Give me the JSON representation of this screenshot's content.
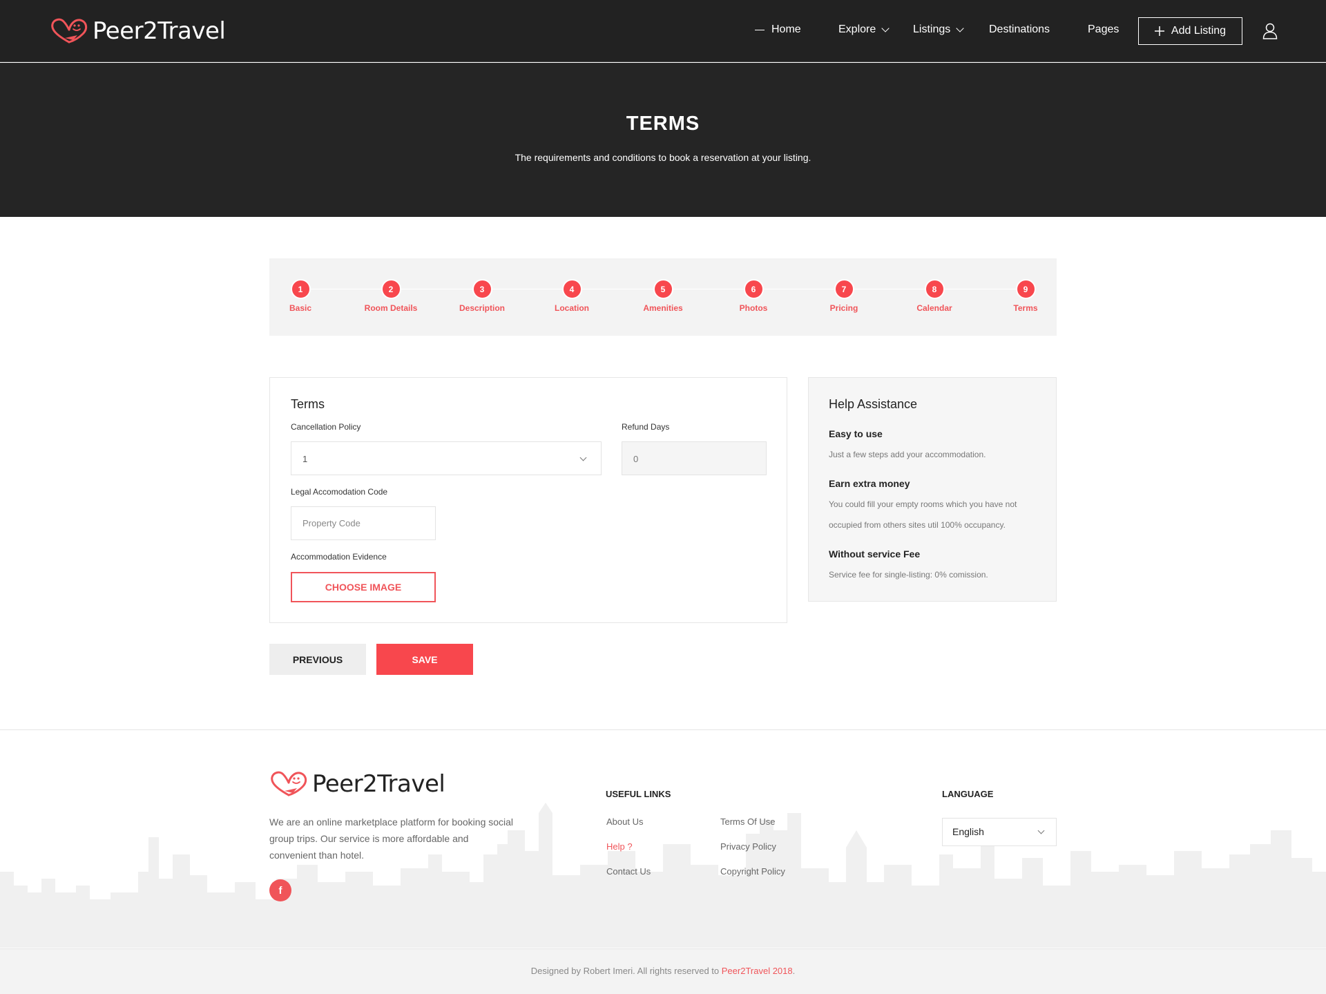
{
  "brand": {
    "name": "Peer2Travel",
    "accent_color": "#f8474d",
    "logo_icon": "heart-smile-plane-logo"
  },
  "nav": {
    "home": "Home",
    "explore": "Explore",
    "listings": "Listings",
    "destinations": "Destinations",
    "pages": "Pages",
    "add_listing": "Add Listing",
    "user_icon": "user-icon"
  },
  "hero": {
    "title": "TERMS",
    "subtitle": "The requirements and conditions to book a reservation at your listing."
  },
  "stepper": {
    "steps": [
      {
        "num": "1",
        "label": "Basic"
      },
      {
        "num": "2",
        "label": "Room Details"
      },
      {
        "num": "3",
        "label": "Description"
      },
      {
        "num": "4",
        "label": "Location"
      },
      {
        "num": "5",
        "label": "Amenities"
      },
      {
        "num": "6",
        "label": "Photos"
      },
      {
        "num": "7",
        "label": "Pricing"
      },
      {
        "num": "8",
        "label": "Calendar"
      },
      {
        "num": "9",
        "label": "Terms"
      }
    ]
  },
  "form": {
    "title": "Terms",
    "cancellation_label": "Cancellation Policy",
    "cancellation_value": "1",
    "refund_label": "Refund Days",
    "refund_value": "0",
    "legal_code_label": "Legal Accomodation Code",
    "legal_code_placeholder": "Property Code",
    "evidence_label": "Accommodation Evidence",
    "choose_image": "CHOOSE IMAGE"
  },
  "help": {
    "title": "Help Assistance",
    "items": [
      {
        "heading": "Easy to use",
        "text": "Just a few steps add your accommodation."
      },
      {
        "heading": "Earn extra money",
        "text": "You could fill your empty rooms which you have not occupied from others sites util 100% occupancy."
      },
      {
        "heading": "Without service Fee",
        "text": "Service fee for single-listing: 0% comission."
      }
    ]
  },
  "actions": {
    "previous": "PREVIOUS",
    "save": "SAVE"
  },
  "footer": {
    "description": "We are an online marketplace platform for booking social group trips. Our service is more affordable and convenient than hotel.",
    "useful_links_title": "USEFUL LINKS",
    "links_col1": [
      "About Us",
      "Help ?",
      "Contact Us"
    ],
    "links_col2": [
      "Terms Of Use",
      "Privacy Policy",
      "Copyright Policy"
    ],
    "language_title": "LANGUAGE",
    "language_value": "English",
    "social_icon": "facebook-icon"
  },
  "copyright": {
    "prefix": "Designed by Robert Imeri. All rights reserved to ",
    "brand_year": "Peer2Travel 2018",
    "suffix": "."
  }
}
